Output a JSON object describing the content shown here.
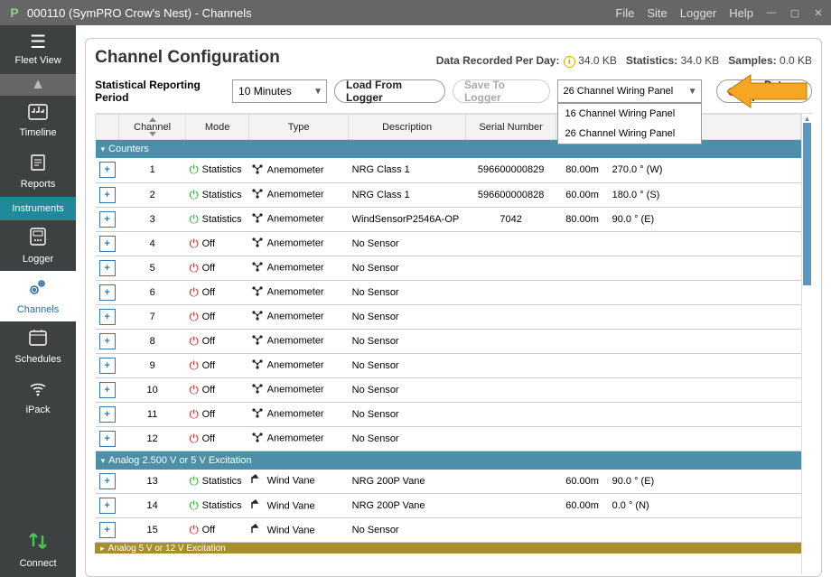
{
  "titlebar": {
    "title": "000110 (SymPRO Crow's Nest) - Channels",
    "menus": [
      "File",
      "Site",
      "Logger",
      "Help"
    ]
  },
  "sidebar": {
    "fleet_view": "Fleet View",
    "timeline": "Timeline",
    "reports": "Reports",
    "instruments": "Instruments",
    "logger": "Logger",
    "channels": "Channels",
    "schedules": "Schedules",
    "ipack": "iPack",
    "connect": "Connect"
  },
  "header": {
    "title": "Channel Configuration",
    "data_label": "Data Recorded Per Day:",
    "data_value": "34.0 KB",
    "stats_label": "Statistics:",
    "stats_value": "34.0 KB",
    "samples_label": "Samples:",
    "samples_value": "0.0 KB"
  },
  "toolbar": {
    "period_label": "Statistical Reporting Period",
    "period_value": "10 Minutes",
    "load": "Load From Logger",
    "save": "Save To Logger",
    "wiring_selected": "26 Channel Wiring Panel",
    "wiring_options": [
      "16 Channel Wiring Panel",
      "26 Channel Wiring Panel"
    ],
    "live": "Live Data Off"
  },
  "columns": {
    "channel": "Channel",
    "mode": "Mode",
    "type": "Type",
    "description": "Description",
    "serial": "Serial Number",
    "height": "",
    "bearing": ""
  },
  "groups": [
    {
      "name": "Counters",
      "rows": [
        {
          "ch": "1",
          "mode": "Statistics",
          "on": true,
          "type": "Anemometer",
          "icon": "anemo",
          "desc": "NRG Class 1",
          "serial": "596600000829",
          "height": "80.00m",
          "bearing": "270.0 ° (W)"
        },
        {
          "ch": "2",
          "mode": "Statistics",
          "on": true,
          "type": "Anemometer",
          "icon": "anemo",
          "desc": "NRG Class 1",
          "serial": "596600000828",
          "height": "60.00m",
          "bearing": "180.0 ° (S)"
        },
        {
          "ch": "3",
          "mode": "Statistics",
          "on": true,
          "type": "Anemometer",
          "icon": "anemo",
          "desc": "WindSensorP2546A-OP",
          "serial": "7042",
          "height": "80.00m",
          "bearing": "90.0 ° (E)"
        },
        {
          "ch": "4",
          "mode": "Off",
          "on": false,
          "type": "Anemometer",
          "icon": "anemo",
          "desc": "No Sensor",
          "serial": "",
          "height": "",
          "bearing": ""
        },
        {
          "ch": "5",
          "mode": "Off",
          "on": false,
          "type": "Anemometer",
          "icon": "anemo",
          "desc": "No Sensor",
          "serial": "",
          "height": "",
          "bearing": ""
        },
        {
          "ch": "6",
          "mode": "Off",
          "on": false,
          "type": "Anemometer",
          "icon": "anemo",
          "desc": "No Sensor",
          "serial": "",
          "height": "",
          "bearing": ""
        },
        {
          "ch": "7",
          "mode": "Off",
          "on": false,
          "type": "Anemometer",
          "icon": "anemo",
          "desc": "No Sensor",
          "serial": "",
          "height": "",
          "bearing": ""
        },
        {
          "ch": "8",
          "mode": "Off",
          "on": false,
          "type": "Anemometer",
          "icon": "anemo",
          "desc": "No Sensor",
          "serial": "",
          "height": "",
          "bearing": ""
        },
        {
          "ch": "9",
          "mode": "Off",
          "on": false,
          "type": "Anemometer",
          "icon": "anemo",
          "desc": "No Sensor",
          "serial": "",
          "height": "",
          "bearing": ""
        },
        {
          "ch": "10",
          "mode": "Off",
          "on": false,
          "type": "Anemometer",
          "icon": "anemo",
          "desc": "No Sensor",
          "serial": "",
          "height": "",
          "bearing": ""
        },
        {
          "ch": "11",
          "mode": "Off",
          "on": false,
          "type": "Anemometer",
          "icon": "anemo",
          "desc": "No Sensor",
          "serial": "",
          "height": "",
          "bearing": ""
        },
        {
          "ch": "12",
          "mode": "Off",
          "on": false,
          "type": "Anemometer",
          "icon": "anemo",
          "desc": "No Sensor",
          "serial": "",
          "height": "",
          "bearing": ""
        }
      ]
    },
    {
      "name": "Analog 2.500 V or 5 V Excitation",
      "rows": [
        {
          "ch": "13",
          "mode": "Statistics",
          "on": true,
          "type": "Wind Vane",
          "icon": "vane",
          "desc": "NRG 200P Vane",
          "serial": "",
          "height": "60.00m",
          "bearing": "90.0 ° (E)"
        },
        {
          "ch": "14",
          "mode": "Statistics",
          "on": true,
          "type": "Wind Vane",
          "icon": "vane",
          "desc": "NRG 200P Vane",
          "serial": "",
          "height": "60.00m",
          "bearing": "0.0 ° (N)"
        },
        {
          "ch": "15",
          "mode": "Off",
          "on": false,
          "type": "Wind Vane",
          "icon": "vane",
          "desc": "No Sensor",
          "serial": "",
          "height": "",
          "bearing": ""
        }
      ]
    }
  ],
  "footer_group": "Analog 5 V or 12 V Excitation"
}
